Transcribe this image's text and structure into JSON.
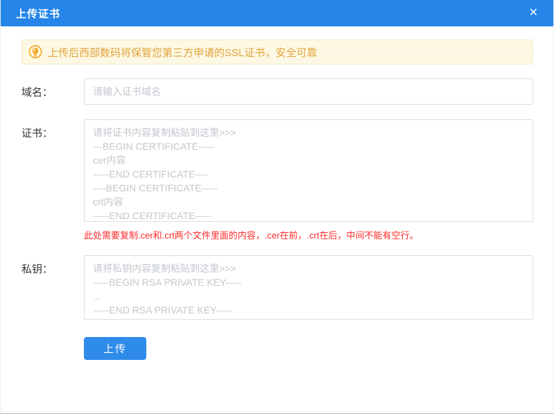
{
  "dialog": {
    "title": "上传证书",
    "close_icon": "✕"
  },
  "notice": {
    "icon": "lightbulb-icon",
    "text": "上传后西部数码将保管您第三方申请的SSL证书，安全可靠"
  },
  "form": {
    "domain": {
      "label": "域名：",
      "placeholder": "请输入证书域名"
    },
    "certificate": {
      "label": "证书：",
      "placeholder": "请将证书内容复制粘贴到这里>>>\n---BEGIN CERTIFICATE-----\ncer内容\n-----END CERTIFICATE----\n----BEGIN CERTIFICATE-----\ncrt内容\n-----END CERTIFICATE-----",
      "hint": "此处需要复制.cer和.crt两个文件里面的内容，.cer在前，.crt在后，中间不能有空行。"
    },
    "private_key": {
      "label": "私钥：",
      "placeholder": "请将私钥内容复制粘贴到这里>>>\n-----BEGIN RSA PRIVATE KEY-----\n...\n-----END RSA PRIVATE KEY-----"
    },
    "submit_label": "上传"
  },
  "colors": {
    "header_bg": "#2585E9",
    "button_bg": "#2E8BE9",
    "notice_bg": "#FDF8E3",
    "notice_text": "#E2A33D",
    "hint_red": "#FF2A2A"
  }
}
